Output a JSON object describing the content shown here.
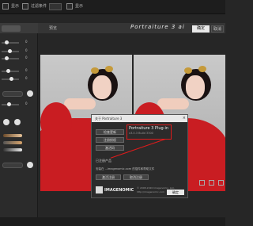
{
  "topbar": {
    "label1": "显示",
    "label2": "过滤条件",
    "label3": "显示"
  },
  "header": {
    "title": "Portraiture 3",
    "title_suffix": "ai",
    "preview_label": "预览",
    "ok_label": "确定",
    "cancel_label": "取消"
  },
  "sidebar": {
    "values": [
      "0",
      "0",
      "0",
      "0",
      "0",
      "0",
      "0",
      "0"
    ],
    "pill_labels": [
      "",
      "",
      ""
    ]
  },
  "dialog": {
    "title": "关于 Portraiture 3",
    "close_symbol": "×",
    "buttons": [
      "检查更新",
      "注册授权",
      "激活码"
    ],
    "product_name": "Portraiture 3 Plug-in",
    "product_version": "v3.0.3 Build 3300",
    "section_label": "已注册产品",
    "info_text": "安装在 ...imagenomic.com 的插件和帮助文件",
    "buttons2": [
      "激活注册",
      "取消注册"
    ],
    "logo_text": "IMAGENOMIC",
    "copyright": "© 2008-2020 Imagenomic, LLC.",
    "website": "http://imagenomic.com",
    "ok_label": "确定"
  },
  "colors": {
    "accent_red": "#e01b1b",
    "dress_red": "#c91d22",
    "background": "#262626"
  }
}
